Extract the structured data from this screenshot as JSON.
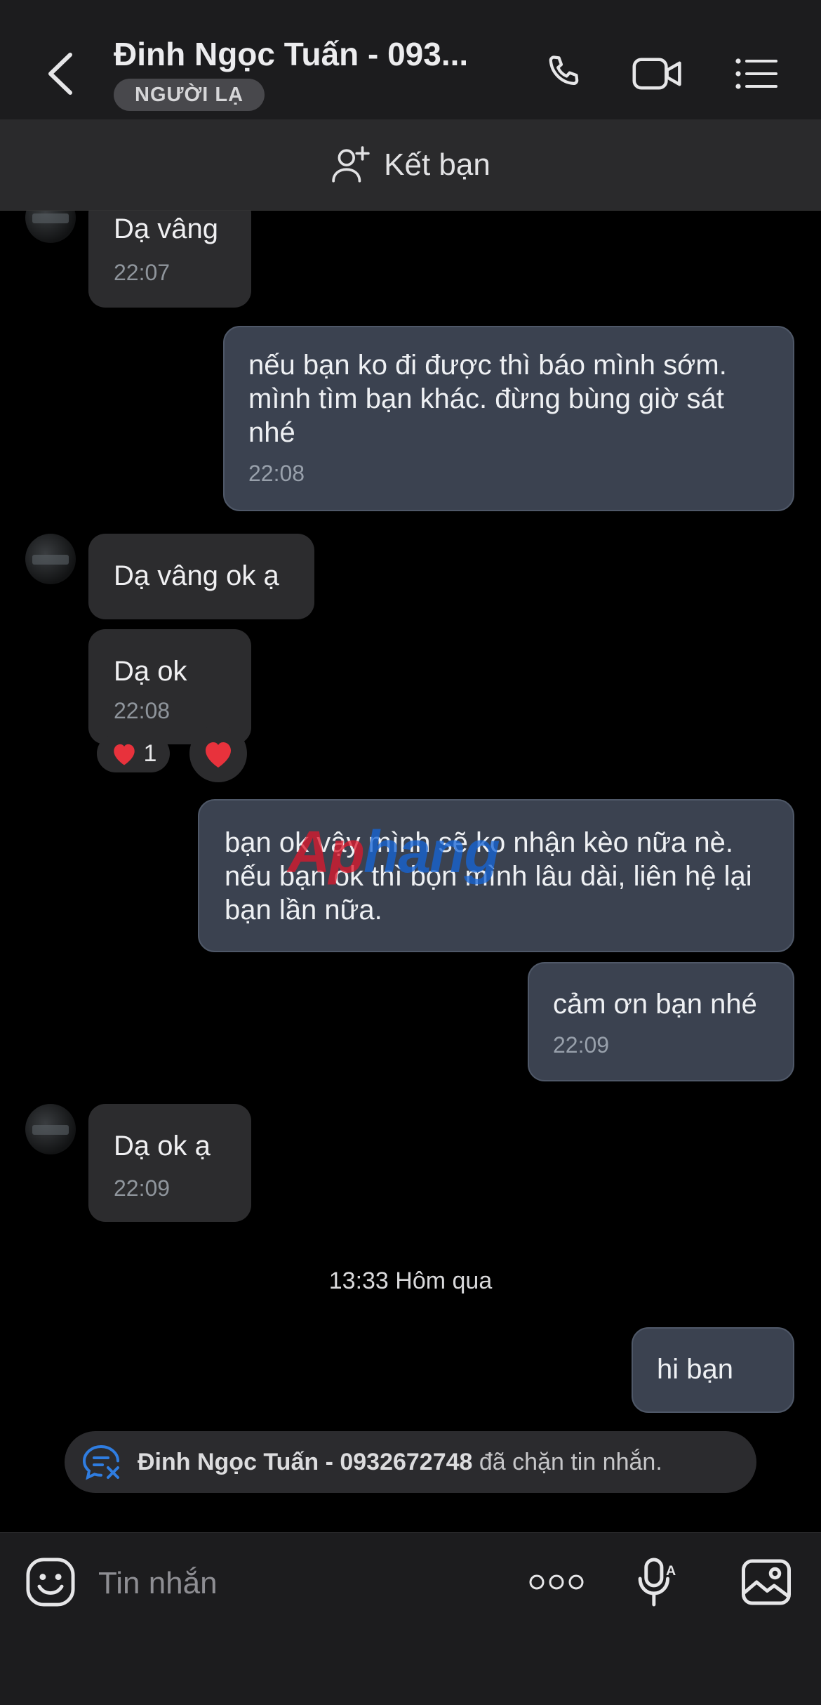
{
  "header": {
    "title": "Đinh Ngọc Tuấn - 093...",
    "badge": "NGƯỜI LẠ"
  },
  "addbar": {
    "label": "Kết bạn"
  },
  "messages": [
    {
      "side": "in",
      "text": "Dạ vâng",
      "time": "22:07"
    },
    {
      "side": "out",
      "text": "nếu bạn ko đi được thì báo mình sớm. mình tìm bạn khác. đừng bùng giờ sát nhé",
      "time": "22:08"
    },
    {
      "side": "in",
      "text": "Dạ vâng ok ạ",
      "time": ""
    },
    {
      "side": "in",
      "text": "Dạ ok",
      "time": "22:08",
      "reaction": {
        "emoji": "❤️",
        "count": "1"
      }
    },
    {
      "side": "out",
      "text": "bạn ok vậy mình sẽ ko nhận kèo nữa nè. nếu bạn ok thì bọn mình lâu dài, liên hệ lại bạn lần nữa.",
      "time": ""
    },
    {
      "side": "out",
      "text": "cảm ơn bạn nhé",
      "time": "22:09"
    },
    {
      "side": "in",
      "text": "Dạ ok ạ",
      "time": "22:09"
    },
    {
      "side": "out",
      "text": "hi bạn",
      "time": ""
    }
  ],
  "date_separator": "13:33 Hôm qua",
  "blocked_notice": {
    "name": "Đinh Ngọc Tuấn - 0932672748",
    "text": "đã chặn tin nhắn."
  },
  "watermark": {
    "part1": "Ap",
    "part2": "hang"
  },
  "input": {
    "placeholder": "Tin nhắn"
  },
  "icons": {
    "back": "chevron-left-icon",
    "call": "phone-icon",
    "video": "video-camera-icon",
    "menu": "list-menu-icon",
    "add_friend": "add-user-icon",
    "sticker": "sticker-smile-icon",
    "more": "more-dots-icon",
    "voice": "microphone-icon",
    "image": "image-icon",
    "blocked": "blocked-chat-icon",
    "heart": "heart-icon"
  },
  "colors": {
    "background": "#000000",
    "header": "#1c1c1e",
    "incoming_bubble": "#2c2c2e",
    "outgoing_bubble": "#3b4250",
    "heart": "#e8323c",
    "blocked_icon": "#2f7de1"
  }
}
